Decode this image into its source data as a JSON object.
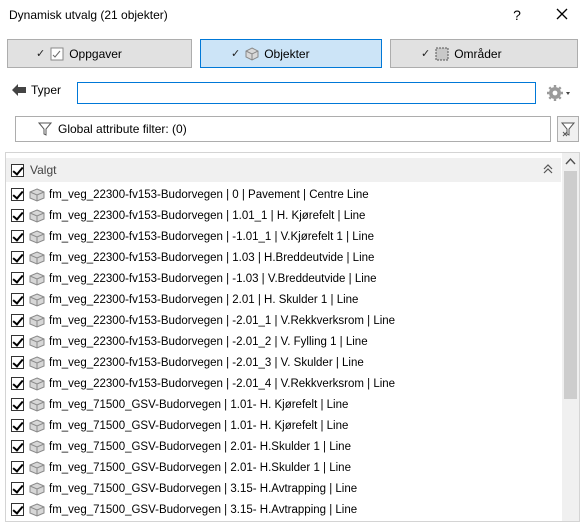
{
  "window": {
    "title": "Dynamisk utvalg (21 objekter)",
    "help_label": "?"
  },
  "modes": [
    {
      "label": "Oppgaver",
      "active": false
    },
    {
      "label": "Objekter",
      "active": true
    },
    {
      "label": "Områder",
      "active": false
    }
  ],
  "types": {
    "back_label": "Typer",
    "search_value": ""
  },
  "filter": {
    "label": "Global attribute filter: (0)"
  },
  "list": {
    "header_label": "Valgt",
    "items": [
      "fm_veg_22300-fv153-Budorvegen | 0 | Pavement | Centre Line",
      "fm_veg_22300-fv153-Budorvegen | 1.01_1 | H. Kjørefelt | Line",
      "fm_veg_22300-fv153-Budorvegen | -1.01_1 | V.Kjørefelt 1 | Line",
      "fm_veg_22300-fv153-Budorvegen | 1.03 | H.Breddeutvide | Line",
      "fm_veg_22300-fv153-Budorvegen | -1.03 | V.Breddeutvide | Line",
      "fm_veg_22300-fv153-Budorvegen | 2.01 | H. Skulder 1 | Line",
      "fm_veg_22300-fv153-Budorvegen | -2.01_1 | V.Rekkverksrom | Line",
      "fm_veg_22300-fv153-Budorvegen | -2.01_2 | V. Fylling 1 | Line",
      "fm_veg_22300-fv153-Budorvegen | -2.01_3 | V. Skulder | Line",
      "fm_veg_22300-fv153-Budorvegen | -2.01_4 | V.Rekkverksrom | Line",
      "fm_veg_71500_GSV-Budorvegen | 1.01- H. Kjørefelt | Line",
      "fm_veg_71500_GSV-Budorvegen | 1.01- H. Kjørefelt | Line",
      "fm_veg_71500_GSV-Budorvegen | 2.01- H.Skulder 1 | Line",
      "fm_veg_71500_GSV-Budorvegen | 2.01- H.Skulder 1 | Line",
      "fm_veg_71500_GSV-Budorvegen | 3.15- H.Avtrapping | Line",
      "fm_veg_71500_GSV-Budorvegen | 3.15- H.Avtrapping | Line"
    ]
  },
  "icons": {
    "back": "arrow-left-icon",
    "settings": "gear-icon",
    "filter": "funnel-icon",
    "clear_filter": "clear-filter-icon",
    "object": "object-cube-icon",
    "collapse": "collapse-chevron-icon"
  }
}
